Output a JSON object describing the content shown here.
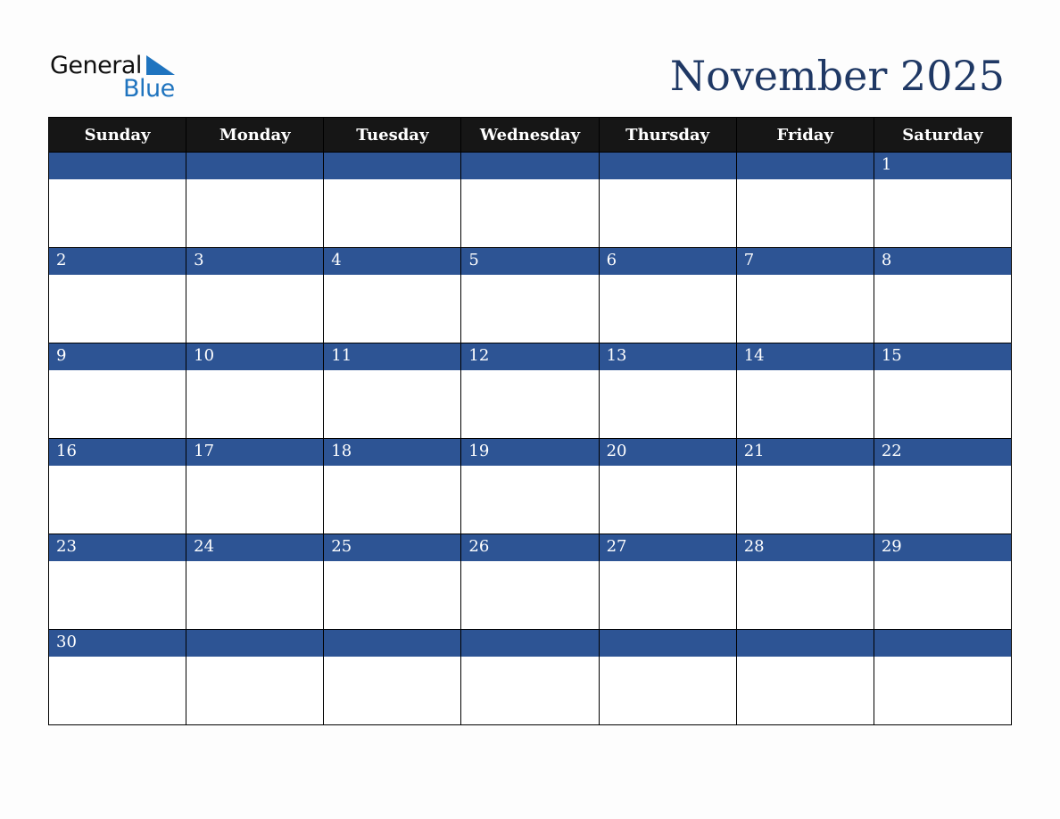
{
  "logo": {
    "line1": "General",
    "line2": "Blue"
  },
  "title": "November 2025",
  "colors": {
    "header_bg": "#161616",
    "band_bg": "#2d5494",
    "title": "#1f3864",
    "logo_blue": "#1f74bf"
  },
  "weekdays": [
    "Sunday",
    "Monday",
    "Tuesday",
    "Wednesday",
    "Thursday",
    "Friday",
    "Saturday"
  ],
  "weeks": [
    [
      "",
      "",
      "",
      "",
      "",
      "",
      "1"
    ],
    [
      "2",
      "3",
      "4",
      "5",
      "6",
      "7",
      "8"
    ],
    [
      "9",
      "10",
      "11",
      "12",
      "13",
      "14",
      "15"
    ],
    [
      "16",
      "17",
      "18",
      "19",
      "20",
      "21",
      "22"
    ],
    [
      "23",
      "24",
      "25",
      "26",
      "27",
      "28",
      "29"
    ],
    [
      "30",
      "",
      "",
      "",
      "",
      "",
      ""
    ]
  ]
}
